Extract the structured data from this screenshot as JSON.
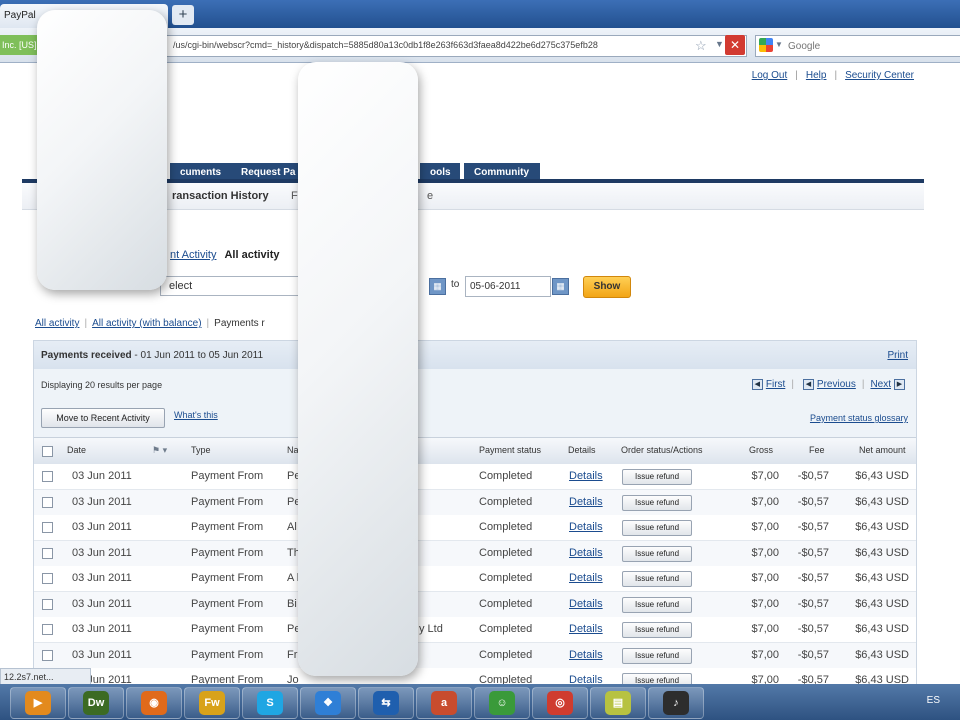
{
  "browser": {
    "tab_title": "PayPal",
    "new_tab_label": "+",
    "site_identity": "Inc. [US]",
    "url": "/us/cgi-bin/webscr?cmd=_history&dispatch=5885d80a13c0db1f8e263f663d3faea8d422be6d275c375efb28",
    "search_placeholder": "Google"
  },
  "header": {
    "links": [
      "Log Out",
      "Help",
      "Security Center"
    ]
  },
  "main_tabs": [
    "cuments",
    "Request Pa",
    "ools",
    "Community"
  ],
  "subnav": {
    "active": "ransaction History",
    "frag1": "F",
    "frag2": "e"
  },
  "activity": {
    "link_text": "nt Activity",
    "active_text": "All activity"
  },
  "search": {
    "select_value": "elect",
    "to_label": "to",
    "date_to": "05-06-2011",
    "show_label": "Show"
  },
  "filters": {
    "all_activity": "All activity",
    "with_balance": "All activity (with balance)",
    "current": "Payments r"
  },
  "results": {
    "title_bold": "Payments received",
    "title_range": "- 01 Jun 2011 to 05 Jun 2011",
    "print_label": "Print",
    "displaying": "Displaying 20 results per page",
    "pager": {
      "first": "First",
      "previous": "Previous",
      "next": "Next"
    },
    "move_label": "Move to Recent Activity",
    "whats_this": "What's this",
    "glossary": "Payment status glossary",
    "columns": [
      "Date",
      "Type",
      "Na",
      "Payment status",
      "Details",
      "Order status/Actions",
      "Gross",
      "Fee",
      "Net amount"
    ],
    "rows": [
      {
        "date": "03 Jun 2011",
        "type": "Payment From",
        "name": "Pe",
        "status": "Completed",
        "details": "Details",
        "action": "Issue refund",
        "gross": "$7,00",
        "fee": "-$0,57",
        "net": "$6,43 USD"
      },
      {
        "date": "03 Jun 2011",
        "type": "Payment From",
        "name": "Pe",
        "status": "Completed",
        "details": "Details",
        "action": "Issue refund",
        "gross": "$7,00",
        "fee": "-$0,57",
        "net": "$6,43 USD"
      },
      {
        "date": "03 Jun 2011",
        "type": "Payment From",
        "name": "Al",
        "status": "Completed",
        "details": "Details",
        "action": "Issue refund",
        "gross": "$7,00",
        "fee": "-$0,57",
        "net": "$6,43 USD"
      },
      {
        "date": "03 Jun 2011",
        "type": "Payment From",
        "name": "Th",
        "status": "Completed",
        "details": "Details",
        "action": "Issue refund",
        "gross": "$7,00",
        "fee": "-$0,57",
        "net": "$6,43 USD"
      },
      {
        "date": "03 Jun 2011",
        "type": "Payment From",
        "name": "A l",
        "status": "Completed",
        "details": "Details",
        "action": "Issue refund",
        "gross": "$7,00",
        "fee": "-$0,57",
        "net": "$6,43 USD"
      },
      {
        "date": "03 Jun 2011",
        "type": "Payment From",
        "name": "Bi",
        "status": "Completed",
        "details": "Details",
        "action": "Issue refund",
        "gross": "$7,00",
        "fee": "-$0,57",
        "net": "$6,43 USD"
      },
      {
        "date": "03 Jun 2011",
        "type": "Payment From",
        "name": "Pe",
        "name_tail": "y Ltd",
        "status": "Completed",
        "details": "Details",
        "action": "Issue refund",
        "gross": "$7,00",
        "fee": "-$0,57",
        "net": "$6,43 USD"
      },
      {
        "date": "03 Jun 2011",
        "type": "Payment From",
        "name": "Fr",
        "status": "Completed",
        "details": "Details",
        "action": "Issue refund",
        "gross": "$7,00",
        "fee": "-$0,57",
        "net": "$6,43 USD"
      },
      {
        "date": "03 Jun 2011",
        "type": "Payment From",
        "name": "Jo",
        "status": "Completed",
        "details": "Details",
        "action": "Issue refund",
        "gross": "$7,00",
        "fee": "-$0,57",
        "net": "$6,43 USD"
      }
    ]
  },
  "statusbar": "12.2s7.net...",
  "taskbar": {
    "apps": [
      {
        "icon": "media-player-icon",
        "glyph": "▶",
        "color": "#e38a1e"
      },
      {
        "icon": "dreamweaver-icon",
        "glyph": "Dw",
        "color": "#3c6b24"
      },
      {
        "icon": "firefox-icon",
        "glyph": "◉",
        "color": "#e06a1b"
      },
      {
        "icon": "fireworks-icon",
        "glyph": "Fw",
        "color": "#d8a21a"
      },
      {
        "icon": "skype-icon",
        "glyph": "S",
        "color": "#1fa6e3"
      },
      {
        "icon": "dropbox-icon",
        "glyph": "❖",
        "color": "#2f7fd6"
      },
      {
        "icon": "teamviewer-icon",
        "glyph": "⇆",
        "color": "#1f5fae"
      },
      {
        "icon": "app-icon",
        "glyph": "a",
        "color": "#c84c2e"
      },
      {
        "icon": "messenger-icon",
        "glyph": "☺",
        "color": "#3a9a3a"
      },
      {
        "icon": "chrome-icon",
        "glyph": "◎",
        "color": "#cf3c2f"
      },
      {
        "icon": "notes-icon",
        "glyph": "▤",
        "color": "#b7c241"
      },
      {
        "icon": "media-icon",
        "glyph": "♪",
        "color": "#2d2d2d"
      }
    ],
    "locale": "ES"
  }
}
